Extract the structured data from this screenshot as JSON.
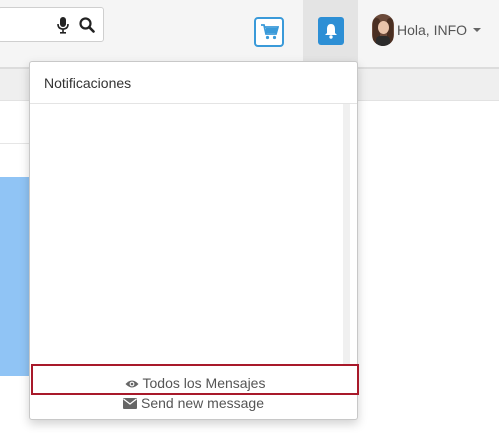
{
  "search": {
    "value": ""
  },
  "header": {
    "user_greeting": "Hola, INFO"
  },
  "notifications": {
    "title": "Notificaciones",
    "all_messages_label": "Todos los Mensajes",
    "send_new_label": "Send new message"
  },
  "colors": {
    "accent_blue": "#2d8fd5",
    "highlight_border": "#a8192a",
    "side_block": "#90c4f5"
  },
  "icons": {
    "mic": "microphone-icon",
    "search": "search-icon",
    "cart": "shopping-cart-icon",
    "bell": "bell-icon",
    "eye": "eye-icon",
    "envelope": "envelope-icon"
  }
}
